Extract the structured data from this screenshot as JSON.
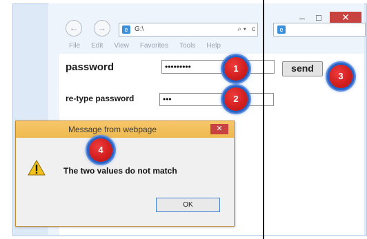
{
  "browser": {
    "address": "G:\\",
    "search_icon": "⌕ ▾",
    "refresh_icon": "c",
    "window_controls": {
      "minimize": "–",
      "maximize": "☐",
      "close": "✕"
    },
    "nav": {
      "back": "←",
      "forward": "→"
    },
    "menu": [
      "File",
      "Edit",
      "View",
      "Favorites",
      "Tools",
      "Help"
    ]
  },
  "form": {
    "password_label": "password",
    "password_value": "•••••••••",
    "retype_label": "re-type password",
    "retype_value": "•••",
    "send_label": "send"
  },
  "markers": [
    "1",
    "2",
    "3",
    "4"
  ],
  "dialog": {
    "title": "Message from webpage",
    "close": "✕",
    "message": "The two values do not match",
    "ok_label": "OK"
  },
  "colors": {
    "marker_fill": "#d31f1f",
    "marker_ring": "#2563c8",
    "dialog_title_bar": "#f6c66a",
    "close_button": "#c8423f"
  }
}
